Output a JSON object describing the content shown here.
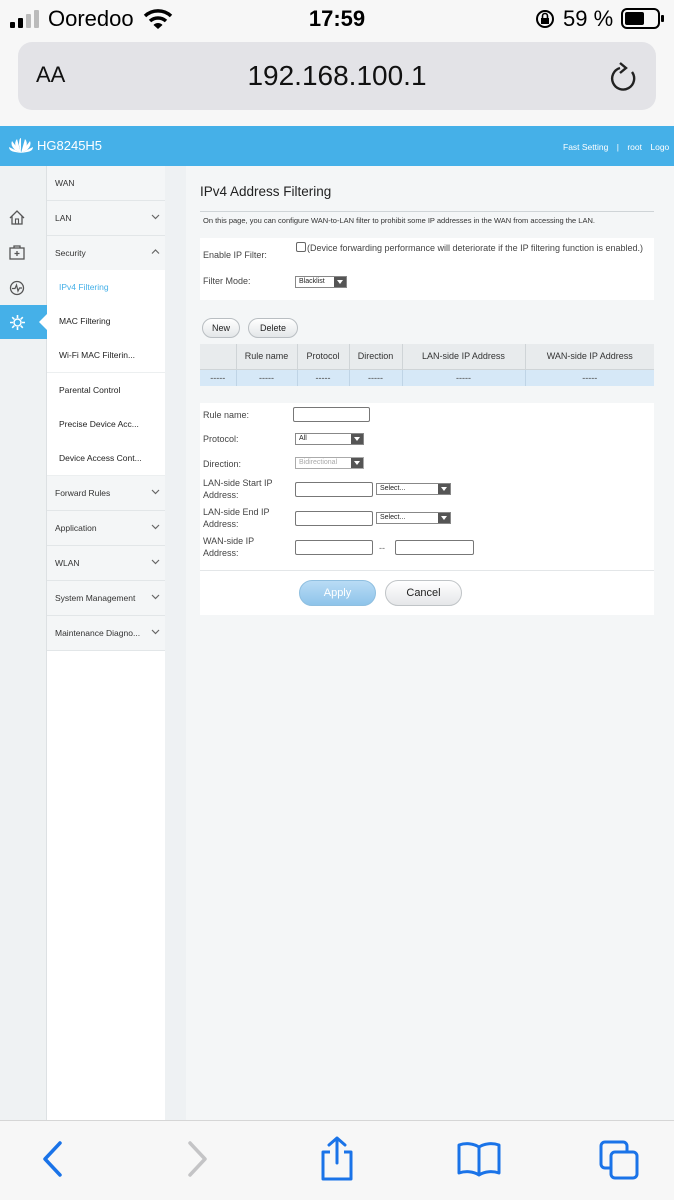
{
  "status_bar": {
    "carrier": "Ooredoo",
    "time": "17:59",
    "battery_percent": "59 %"
  },
  "browser": {
    "text_size_label": "AA",
    "url": "192.168.100.1"
  },
  "router_header": {
    "model": "HG8245H5",
    "fast_setting": "Fast Setting",
    "user": "root",
    "logout": "Logo"
  },
  "sidebar": {
    "items": [
      {
        "label": "WAN"
      },
      {
        "label": "LAN"
      },
      {
        "label": "Security"
      },
      {
        "label": "Forward Rules"
      },
      {
        "label": "Application"
      },
      {
        "label": "WLAN"
      },
      {
        "label": "System Management"
      },
      {
        "label": "Maintenance Diagno..."
      }
    ],
    "security_subitems": [
      {
        "label": "IPv4 Filtering",
        "active": true
      },
      {
        "label": "MAC Filtering"
      },
      {
        "label": "Wi-Fi MAC Filterin..."
      },
      {
        "label": "Parental Control"
      },
      {
        "label": "Precise Device Acc..."
      },
      {
        "label": "Device Access Cont..."
      }
    ]
  },
  "page": {
    "title": "IPv4 Address Filtering",
    "description": "On this page, you can configure WAN-to-LAN filter to prohibit some IP addresses in the WAN from accessing the LAN.",
    "enable_label": "Enable IP Filter:",
    "enable_note": "(Device forwarding performance will deteriorate if the IP filtering function is enabled.)",
    "filter_mode_label": "Filter Mode:",
    "filter_mode_value": "Blacklist",
    "new_label": "New",
    "delete_label": "Delete"
  },
  "rules_table": {
    "headers": [
      "",
      "Rule name",
      "Protocol",
      "Direction",
      "LAN-side IP Address",
      "WAN-side IP Address"
    ],
    "rows": [
      [
        "-----",
        "-----",
        "-----",
        "-----",
        "-----",
        "-----"
      ]
    ]
  },
  "form": {
    "rule_name_label": "Rule name:",
    "protocol_label": "Protocol:",
    "protocol_value": "All",
    "direction_label": "Direction:",
    "direction_value": "Bidirectional",
    "lan_start_label": "LAN-side Start IP Address:",
    "lan_end_label": "LAN-side End IP Address:",
    "wan_label": "WAN-side IP Address:",
    "select_placeholder": "Select...",
    "range_separator": "--",
    "apply_label": "Apply",
    "cancel_label": "Cancel"
  },
  "colors": {
    "accent": "#45b0e8",
    "ios_blue": "#1a73e8"
  }
}
